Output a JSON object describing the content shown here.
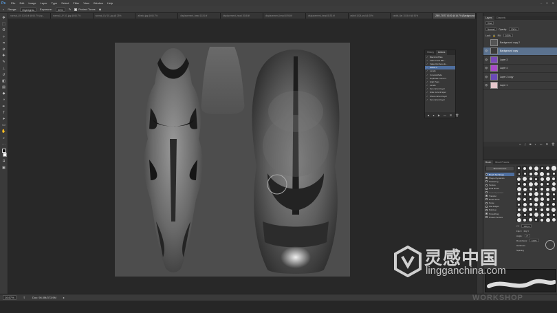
{
  "app": {
    "logo": "Ps"
  },
  "menu": [
    "File",
    "Edit",
    "Image",
    "Layer",
    "Type",
    "Select",
    "Filter",
    "View",
    "Window",
    "Help"
  ],
  "window_controls": [
    "–",
    "□",
    "✕"
  ],
  "options_bar": {
    "range_label": "Range:",
    "range_value": "Highlights",
    "exposure_label": "Exposure:",
    "exposure_value": "20%",
    "protect_tones": "Protect Tones"
  },
  "doc_tabs": [
    "normal_UV 1024.tif @ 66.7% (sp...",
    "normal_UV 10..jpg @ 66.7%",
    "normal_UV 10..jpg @ 25%",
    "albedo.jpg @ 66.7%",
    "displacement_head 1024.tif",
    "displacement_head 2048.tif",
    "displacement_head 4096.tif",
    "displacement_head 8192.tif",
    "rabbit 1024.psd @ 25%",
    "rabbit_flat 1024.tif @ 50%",
    "ZBR_TEST 8192 @ 16.7% (Background copy, RGB/16*)"
  ],
  "active_tab_index": 10,
  "actions_panel": {
    "tabs": [
      "History",
      "Actions"
    ],
    "active_tab": "Actions",
    "items": [
      "Black & White",
      "Faded Grid Blur...",
      "Faded Emboss E...",
      "Action 1",
      "Levels",
      "Curves/Mode",
      "Duplicate current...",
      "High Pass",
      "Levels",
      "Set current layer",
      "Hide current layer",
      "Show current layer",
      "Set current layer"
    ],
    "selected_index": 3
  },
  "layers_panel": {
    "tabs": [
      "Layers",
      "Channels"
    ],
    "kind": "Kind",
    "blend_mode": "Normal",
    "opacity_label": "Opacity:",
    "opacity": "100%",
    "lock_label": "Lock:",
    "fill_label": "Fill:",
    "fill": "100%",
    "layers": [
      {
        "name": "Background copy 2",
        "visible": false,
        "thumb": "#555555"
      },
      {
        "name": "Background copy",
        "visible": true,
        "thumb": "#3a3a3a",
        "selected": true
      },
      {
        "name": "Layer 3",
        "visible": true,
        "thumb": "#7a4bb8"
      },
      {
        "name": "Layer 4",
        "visible": true,
        "thumb": "#a84ac8"
      },
      {
        "name": "Layer 2 copy",
        "visible": true,
        "thumb": "#6a4ab8"
      },
      {
        "name": "Layer 1",
        "visible": true,
        "thumb": "#e6c8cc"
      }
    ]
  },
  "brush_panel": {
    "tabs": [
      "Brush",
      "Brush Presets"
    ],
    "presets_button": "Brush Presets",
    "options": [
      {
        "label": "Brush Tip Shape",
        "checked": false,
        "selected": true
      },
      {
        "label": "Shape Dynamics",
        "checked": true
      },
      {
        "label": "Scattering",
        "checked": false
      },
      {
        "label": "Texture",
        "checked": false
      },
      {
        "label": "Dual Brush",
        "checked": false
      },
      {
        "label": "Color Dynamics",
        "checked": false,
        "dim": true
      },
      {
        "label": "Transfer",
        "checked": true
      },
      {
        "label": "Brush Pose",
        "checked": false
      },
      {
        "label": "Noise",
        "checked": false
      },
      {
        "label": "Wet Edges",
        "checked": false
      },
      {
        "label": "Build-up",
        "checked": false
      },
      {
        "label": "Smoothing",
        "checked": true
      },
      {
        "label": "Protect Texture",
        "checked": false
      }
    ],
    "size_value": "100 px",
    "flip_x": "Flip X",
    "flip_y": "Flip Y",
    "angle_label": "Angle:",
    "angle_value": "0°",
    "roundness_label": "Roundness:",
    "roundness_value": "100%",
    "hardness_label": "Hardness",
    "spacing_label": "Spacing"
  },
  "status_bar": {
    "zoom": "16.67%",
    "doc_info": "Doc: 96.0M/373.9M"
  },
  "watermark": {
    "title": "灵感中国",
    "url": "lingganchina.com",
    "sub": "WORKSHOP"
  }
}
